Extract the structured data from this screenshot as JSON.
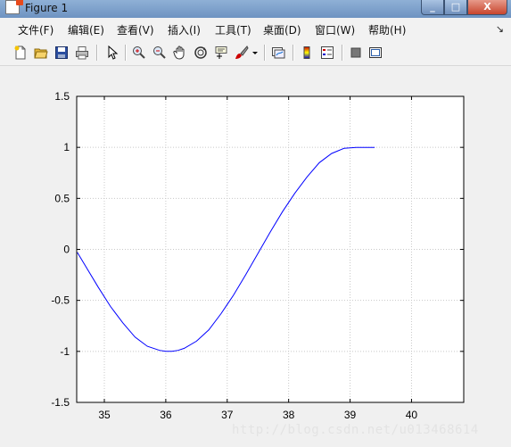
{
  "window": {
    "title": "Figure 1",
    "controls": {
      "minimize": "_",
      "maximize": "□",
      "close": "X"
    }
  },
  "menu": [
    {
      "label": "文件(F)"
    },
    {
      "label": "编辑(E)"
    },
    {
      "label": "查看(V)"
    },
    {
      "label": "插入(I)"
    },
    {
      "label": "工具(T)"
    },
    {
      "label": "桌面(D)"
    },
    {
      "label": "窗口(W)"
    },
    {
      "label": "帮助(H)"
    }
  ],
  "menu_overflow": "↘",
  "toolbar": [
    {
      "icon": "new-figure-icon"
    },
    {
      "icon": "open-file-icon"
    },
    {
      "icon": "save-icon"
    },
    {
      "icon": "print-icon"
    },
    {
      "icon": "edit-plot-arrow-icon"
    },
    {
      "icon": "zoom-in-icon"
    },
    {
      "icon": "zoom-out-icon"
    },
    {
      "icon": "pan-hand-icon"
    },
    {
      "icon": "rotate-3d-icon"
    },
    {
      "icon": "data-cursor-icon"
    },
    {
      "icon": "brush-icon"
    },
    {
      "icon": "brush-dropdown-icon"
    },
    {
      "icon": "link-plot-icon"
    },
    {
      "icon": "colorbar-icon"
    },
    {
      "icon": "legend-icon"
    },
    {
      "icon": "hide-plot-tools-icon"
    },
    {
      "icon": "show-plot-tools-icon"
    }
  ],
  "chart_data": {
    "type": "line",
    "title": "",
    "xlabel": "",
    "ylabel": "",
    "xlim": [
      34.55,
      40.85
    ],
    "ylim": [
      -1.5,
      1.5
    ],
    "xticks": [
      35,
      36,
      37,
      38,
      39,
      40
    ],
    "yticks": [
      -1.5,
      -1,
      -0.5,
      0,
      0.5,
      1,
      1.5
    ],
    "xtick_labels": [
      "35",
      "36",
      "37",
      "38",
      "39",
      "40"
    ],
    "ytick_labels": [
      "-1.5",
      "-1",
      "-0.5",
      "0",
      "0.5",
      "1",
      "1.5"
    ],
    "grid": true,
    "series": [
      {
        "color": "#0000ff",
        "x": [
          34.56,
          34.7,
          34.9,
          35.1,
          35.3,
          35.5,
          35.7,
          35.9,
          36.0,
          36.1,
          36.2,
          36.3,
          36.5,
          36.7,
          36.9,
          37.1,
          37.3,
          37.5,
          37.7,
          37.9,
          38.1,
          38.3,
          38.5,
          38.7,
          38.9,
          39.1,
          39.2,
          39.3,
          39.4
        ],
        "y": [
          -0.03,
          -0.17,
          -0.37,
          -0.56,
          -0.72,
          -0.86,
          -0.95,
          -0.99,
          -1.0,
          -1.0,
          -0.99,
          -0.97,
          -0.9,
          -0.79,
          -0.63,
          -0.45,
          -0.25,
          -0.04,
          0.17,
          0.37,
          0.55,
          0.71,
          0.85,
          0.94,
          0.99,
          1.0,
          1.0,
          1.0,
          1.0
        ]
      }
    ]
  },
  "watermark": "http://blog.csdn.net/u013468614"
}
